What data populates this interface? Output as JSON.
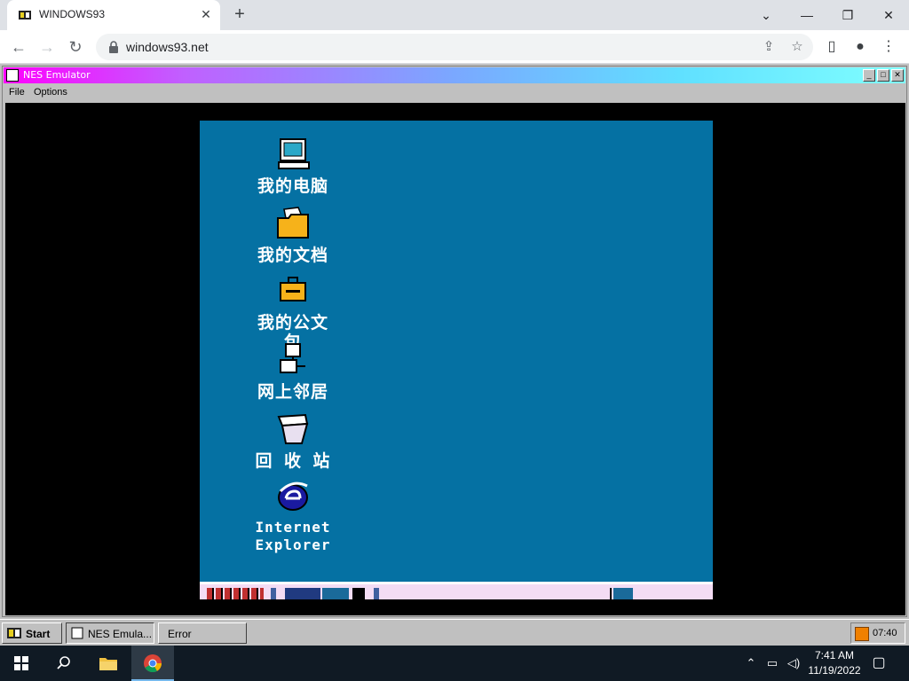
{
  "browser": {
    "tab_title": "WINDOWS93",
    "url": "windows93.net",
    "icons": {
      "close": "✕",
      "new_tab": "+",
      "dropdown": "⌄",
      "minimize": "—",
      "restore": "❐",
      "window_close": "✕",
      "back": "←",
      "forward": "→",
      "reload": "↻",
      "share": "⇪",
      "bookmark": "☆",
      "sidebar": "▯",
      "profile": "●",
      "menu": "⋮"
    }
  },
  "nes_window": {
    "title": "NES Emulator",
    "menu": [
      "File",
      "Options"
    ],
    "buttons": {
      "minimize": "_",
      "maximize": "□",
      "close": "✕"
    }
  },
  "game_desktop": {
    "icons": [
      {
        "label": "我的电脑",
        "icon": "computer-icon"
      },
      {
        "label": "我的文档",
        "icon": "folder-icon"
      },
      {
        "label": "我的公文包",
        "icon": "briefcase-icon"
      },
      {
        "label": "网上邻居",
        "icon": "network-icon"
      },
      {
        "label": "回 收 站",
        "icon": "recycle-bin-icon"
      },
      {
        "label": "Internet Explorer",
        "icon": "ie-icon"
      }
    ]
  },
  "w93_taskbar": {
    "start": "Start",
    "windows": [
      "NES Emula...",
      "Error"
    ],
    "clock": "07:40"
  },
  "os_taskbar": {
    "time": "7:41 AM",
    "date": "11/19/2022"
  },
  "colors": {
    "game_bg": "#0571a3",
    "titlebar_gradient": [
      "#ff00ff",
      "#80ffff"
    ]
  }
}
